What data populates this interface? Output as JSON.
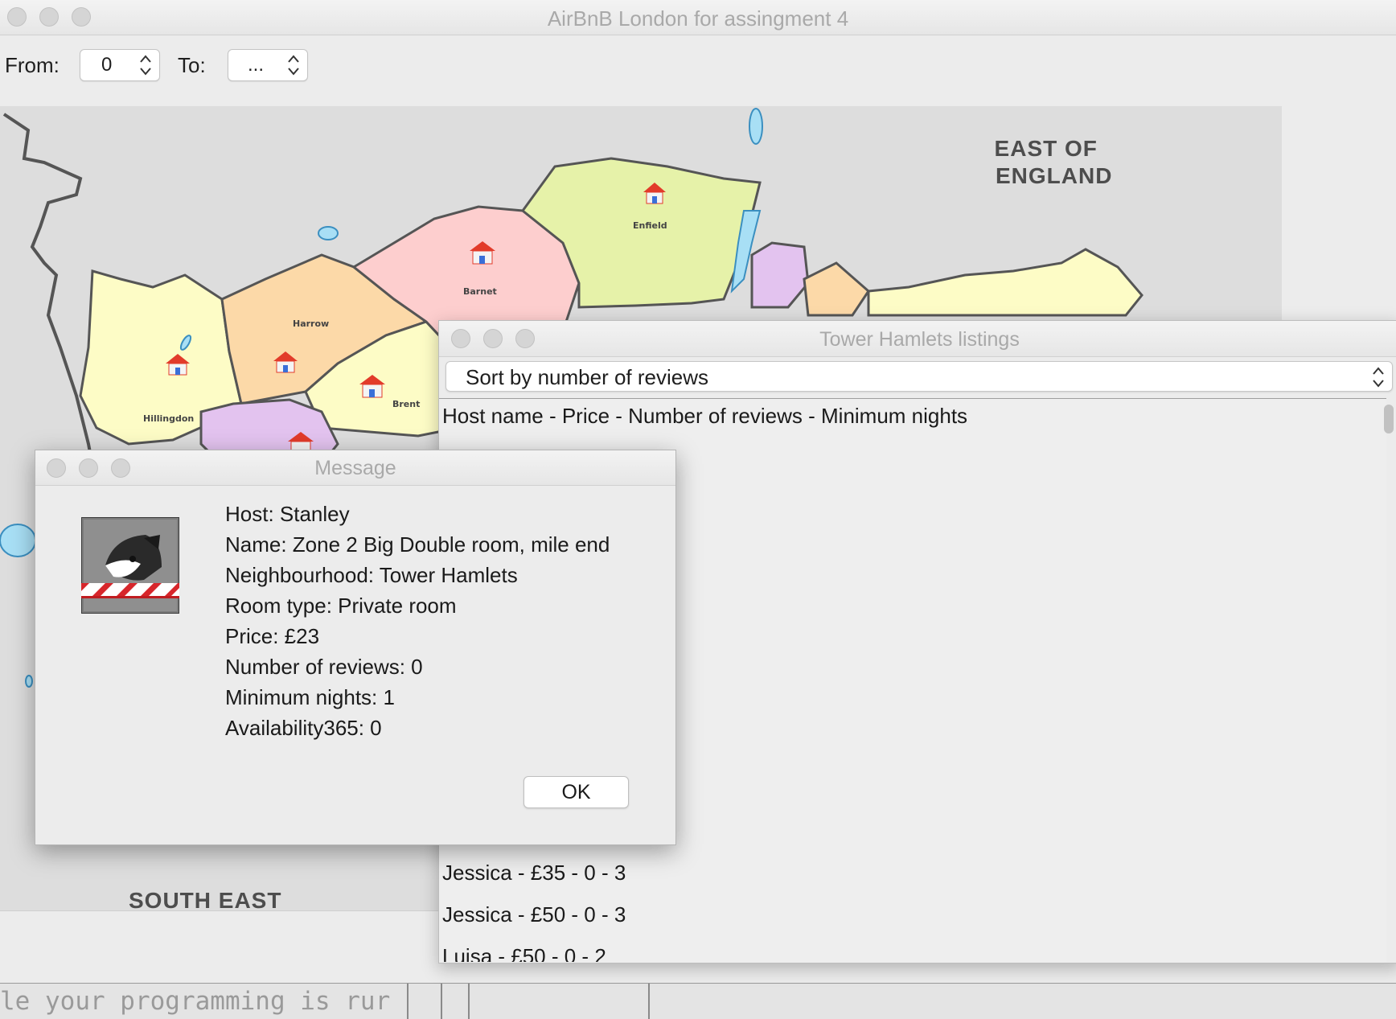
{
  "main_window": {
    "title": "AirBnB London for assingment 4",
    "from_label": "From:",
    "from_value": "0",
    "to_label": "To:",
    "to_value": "..."
  },
  "map": {
    "regions": {
      "east_of_england_line1": "EAST OF",
      "east_of_england_line2": "ENGLAND",
      "south_east": "SOUTH EAST"
    },
    "boroughs": [
      "Enfield",
      "Barnet",
      "Harrow",
      "Hillingdon",
      "Brent"
    ]
  },
  "terminal": {
    "text": "le your programming is rur"
  },
  "listings_window": {
    "title": "Tower Hamlets listings",
    "sort_selected": "Sort by number of reviews",
    "header": "Host name - Price - Number of reviews - Minimum nights",
    "rows": [
      "Jessica - £35 - 0 - 3",
      "Jessica - £50 - 0 - 3",
      "Luisa - £50 - 0 - 2"
    ]
  },
  "message_dialog": {
    "title": "Message",
    "lines": [
      "Host: Stanley",
      "Name: Zone 2 Big Double room, mile end",
      "Neighbourhood: Tower Hamlets",
      "Room type: Private room",
      "Price: £23",
      "Number of reviews: 0",
      "Minimum nights: 1",
      "Availability365: 0"
    ],
    "ok_label": "OK",
    "icon": "java-duke-icon"
  },
  "colors": {
    "window_bg": "#ececec",
    "map_bg": "#dddddd",
    "title_text": "#a9a9a9"
  }
}
